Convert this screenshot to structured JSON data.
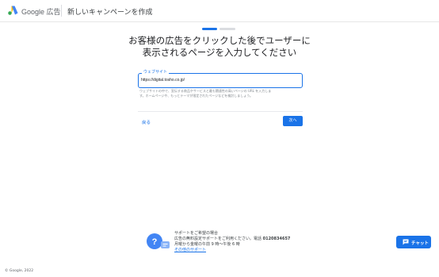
{
  "header": {
    "brand": "Google 広告",
    "page_title": "新しいキャンペーンを作成",
    "logo_icon": "google-ads-logo-icon"
  },
  "progress": {
    "completed_steps": 1,
    "total_steps": 2
  },
  "main": {
    "headline_line1": "お客様の広告をクリックした後でユーザーに",
    "headline_line2": "表示されるページを入力してください",
    "website_field": {
      "label": "ウェブサイト",
      "value": "https://digital.tosho.co.jp/"
    },
    "helper_line1": "ウェブサイトの中で、宣伝する商品やサービスと最も関連性の高いページの URL を入力しま",
    "helper_line2": "す。ホームページや、もっとテーマが限定されたページなどを検討しましょう。",
    "back_label": "戻る",
    "next_label": "次へ"
  },
  "support": {
    "line1": "サポートをご希望の場合",
    "line2": "広告の無料設定サポートをご利用ください。電話",
    "phone": "0120834657",
    "line3": "月曜から金曜の午前 9 時〜午後 6 時",
    "link": "その他のサポート",
    "icon": "help-chat-icon"
  },
  "chat": {
    "label": "チャット",
    "icon": "chat-icon"
  },
  "footer": {
    "copyright": "© Google, 2022"
  },
  "colors": {
    "accent": "#1a73e8",
    "progress_track": "#dadce0"
  }
}
